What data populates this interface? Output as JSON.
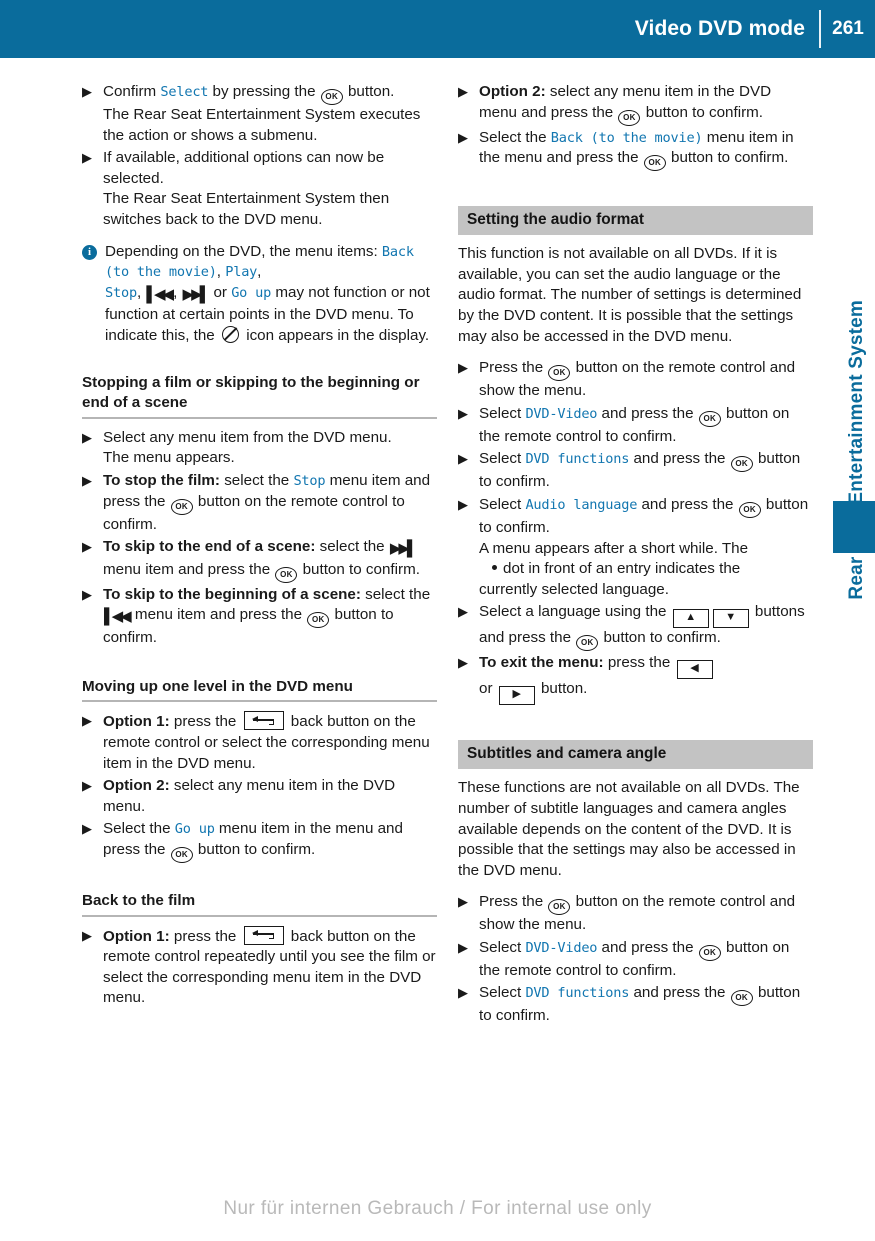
{
  "header": {
    "title": "Video DVD mode",
    "page_number": "261"
  },
  "side": {
    "chapter_label": "Rear Seat Entertainment System"
  },
  "icons": {
    "ok_button": "OK",
    "back_button": "back-button",
    "skip_forward": "skip-forward",
    "skip_back": "skip-back",
    "no_function": "no-function",
    "info": "i",
    "up_button": "▲",
    "down_button": "▼",
    "left_button": "◀",
    "right_button": "▶",
    "bullet": "▶"
  },
  "left_column": {
    "items_top": [
      {
        "lead": "Confirm ",
        "mono1": "Select",
        "mid": " by pressing the ",
        "has_ok": true,
        "tail": " button.",
        "continuation": "The Rear Seat Entertainment System executes the action or shows a submenu."
      },
      {
        "lead": "If available, additional options can now be selected.",
        "continuation": "The Rear Seat Entertainment System then switches back to the DVD menu."
      }
    ],
    "info_note": {
      "t1": "Depending on the DVD, the menu items: ",
      "m1": "Back (to the movie)",
      "t2": ", ",
      "m2": "Play",
      "t3": ", ",
      "m3": "Stop",
      "t4": ", ",
      "t5": ", ",
      "t6": " or ",
      "m4": "Go up",
      "t7": " may not function or not function at certain points in the DVD menu. To indicate this, the ",
      "t8": " icon appears in the display."
    },
    "heading_1": "Stopping a film or skipping to the beginning or end of a scene",
    "sec1_items": [
      {
        "lead": "Select any menu item from the DVD menu.",
        "continuation": "The menu appears."
      },
      {
        "bold": "To stop the film:",
        "lead": " select the ",
        "mono1": "Stop",
        "mid": " menu item and press the ",
        "has_ok": true,
        "tail": " button on the remote control to confirm."
      },
      {
        "bold": "To skip to the end of a scene:",
        "lead": " select the ",
        "icon": "skip-forward",
        "mid": " menu item and press the ",
        "has_ok": true,
        "tail": " button to confirm."
      },
      {
        "bold": "To skip to the beginning of a scene:",
        "lead": " select the ",
        "icon": "skip-back",
        "mid": " menu item and press the ",
        "has_ok": true,
        "tail": " button to confirm."
      }
    ],
    "heading_2": "Moving up one level in the DVD menu",
    "sec2_items": [
      {
        "bold": "Option 1:",
        "lead": " press the ",
        "icon": "back-button",
        "tail": " back button on the remote control or select the corresponding menu item in the DVD menu."
      },
      {
        "bold": "Option 2:",
        "lead": " select any menu item in the DVD menu."
      },
      {
        "lead": "Select the ",
        "mono1": "Go up",
        "mid": " menu item in the menu and press the ",
        "has_ok": true,
        "tail": " button to confirm."
      }
    ],
    "heading_3": "Back to the film",
    "sec3_items": [
      {
        "bold": "Option 1:",
        "lead": " press the ",
        "icon": "back-button",
        "tail": " back button on the remote control repeatedly until you see the film or select the corresponding menu item in the DVD menu."
      }
    ]
  },
  "right_column": {
    "items_top": [
      {
        "bold": "Option 2:",
        "lead": " select any menu item in the DVD menu and press the ",
        "has_ok": true,
        "tail": " button to confirm."
      },
      {
        "lead": "Select the ",
        "mono1": "Back (to the movie)",
        "mid": " menu item in the menu and press the ",
        "has_ok": true,
        "tail": " button to confirm."
      }
    ],
    "band_1": "Setting the audio format",
    "para_1": "This function is not available on all DVDs. If it is available, you can set the audio language or the audio format. The number of settings is determined by the DVD content. It is possible that the settings may also be accessed in the DVD menu.",
    "sec1_items": [
      {
        "lead": "Press the ",
        "has_ok": true,
        "tail": " button on the remote control and show the menu."
      },
      {
        "lead": "Select  ",
        "mono1": "DVD-Video",
        "mid": " and press the ",
        "has_ok": true,
        "tail": " button on the remote control to confirm."
      },
      {
        "lead": "Select ",
        "mono1": "DVD functions",
        "mid": " and press the ",
        "has_ok": true,
        "tail": " button to confirm."
      },
      {
        "lead": "Select ",
        "mono1": "Audio language",
        "mid": " and press the ",
        "has_ok": true,
        "tail": " button to confirm.",
        "continuation": "A menu appears after a short while. The",
        "dot_line": "dot in front of an entry indicates the",
        "continuation2": "currently selected language."
      },
      {
        "lead": "Select a language using the ",
        "icon": "up-down",
        "mid": " buttons and press the ",
        "has_ok": true,
        "tail": " button to confirm."
      },
      {
        "bold": "To exit the menu:",
        "lead": " press the ",
        "icon": "left",
        "mid2": "or ",
        "icon2": "right",
        "tail": " button."
      }
    ],
    "band_2": "Subtitles and camera angle",
    "para_2": "These functions are not available on all DVDs. The number of subtitle languages and camera angles available depends on the content of the DVD. It is possible that the settings may also be accessed in the DVD menu.",
    "sec2_items": [
      {
        "lead": "Press the ",
        "has_ok": true,
        "tail": " button on the remote control and show the menu."
      },
      {
        "lead": "Select  ",
        "mono1": "DVD-Video",
        "mid": " and press the ",
        "has_ok": true,
        "tail": " button on the remote control to confirm."
      },
      {
        "lead": "Select ",
        "mono1": "DVD functions",
        "mid": " and press the ",
        "has_ok": true,
        "tail": " button to confirm."
      }
    ]
  },
  "footer": {
    "watermark": "Nur für internen Gebrauch / For internal use only"
  },
  "colors": {
    "brand_blue": "#0a6c9c",
    "mono_blue": "#1276b0",
    "band_gray": "#c3c3c3"
  }
}
